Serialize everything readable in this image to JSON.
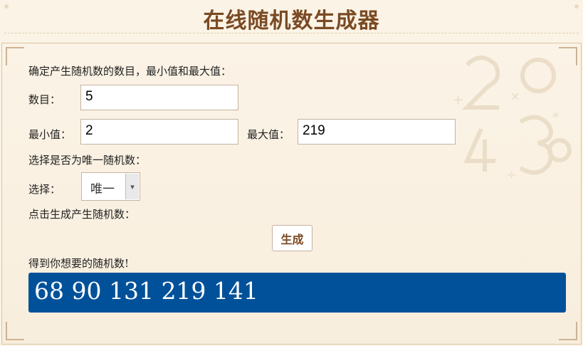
{
  "page": {
    "title": "在线随机数生成器"
  },
  "form": {
    "instruction": "确定产生随机数的数目，最小值和最大值：",
    "count_label": "数目：",
    "count_value": "5",
    "min_label": "最小值：",
    "min_value": "2",
    "max_label": "最大值：",
    "max_value": "219",
    "unique_instruction": "选择是否为唯一随机数：",
    "select_label": "选择：",
    "select_value": "唯一",
    "generate_instruction": "点击生成产生随机数：",
    "generate_button": "生成"
  },
  "result": {
    "label": "得到你想要的随机数!",
    "numbers": "68  90  131  219  141"
  },
  "colors": {
    "title": "#7a4a24",
    "result_background": "#00519a",
    "page_background": "#fbf4e6"
  }
}
